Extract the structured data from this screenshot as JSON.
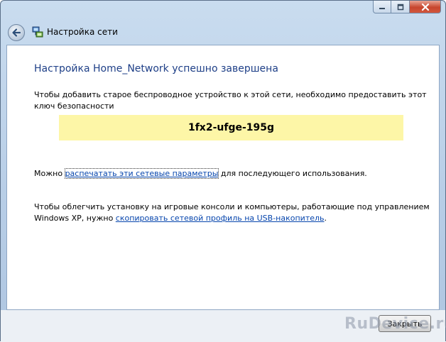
{
  "window": {
    "title": "Настройка сети",
    "colors": {
      "heading": "#1e3f87",
      "link": "#0645ad",
      "key_background": "#fdf6a7"
    }
  },
  "main": {
    "heading": "Настройка Home_Network успешно завершена",
    "instruction": "Чтобы добавить старое беспроводное устройство к этой сети, необходимо предоставить этот ключ безопасности",
    "security_key": "1fx2-ufge-195g",
    "print_prefix": "Можно ",
    "print_link": "распечатать эти сетевые параметры",
    "print_suffix": " для последующего использования.",
    "usb_prefix": "Чтобы облегчить установку на игровые консоли и компьютеры, работающие под управлением Windows XP, нужно ",
    "usb_link": "скопировать сетевой профиль на USB-накопитель",
    "usb_suffix": "."
  },
  "footer": {
    "close_label": "Закрыть"
  },
  "watermark": {
    "text": "RuDevice.ru"
  },
  "icons": [
    "back-arrow-icon",
    "network-setup-icon",
    "minimize-icon",
    "maximize-icon",
    "close-icon"
  ]
}
